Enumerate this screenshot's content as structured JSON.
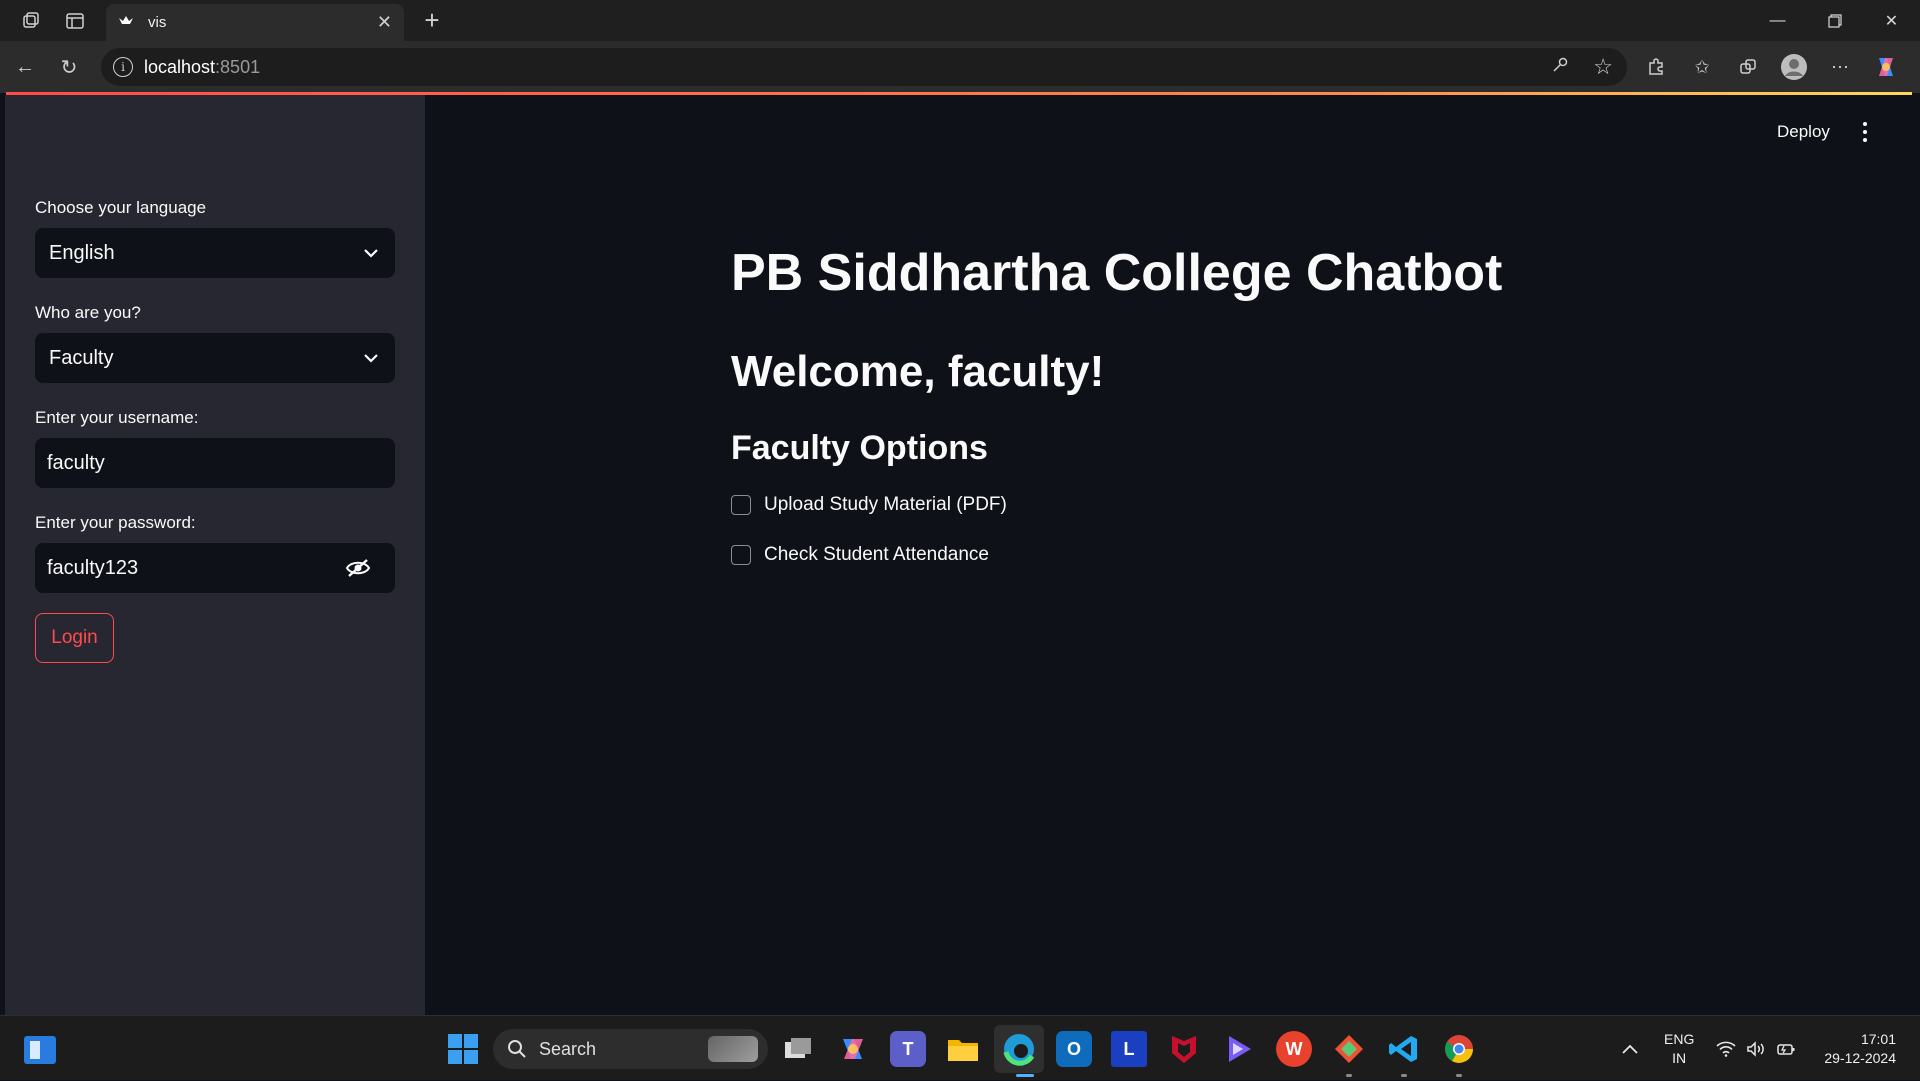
{
  "browser": {
    "tab_title": "vis",
    "url_host": "localhost",
    "url_port": ":8501"
  },
  "sidebar": {
    "language": {
      "label": "Choose your language",
      "value": "English"
    },
    "role": {
      "label": "Who are you?",
      "value": "Faculty"
    },
    "username": {
      "label": "Enter your username:",
      "value": "faculty"
    },
    "password": {
      "label": "Enter your password:",
      "value": "faculty123"
    },
    "login_label": "Login"
  },
  "header": {
    "deploy_label": "Deploy"
  },
  "main": {
    "title": "PB Siddhartha College Chatbot",
    "welcome": "Welcome, faculty!",
    "section_title": "Faculty Options",
    "options": [
      {
        "label": "Upload Study Material (PDF)",
        "checked": false
      },
      {
        "label": "Check Student Attendance",
        "checked": false
      }
    ]
  },
  "taskbar": {
    "search_label": "Search",
    "language_line1": "ENG",
    "language_line2": "IN",
    "time": "17:01",
    "date": "29-12-2024"
  },
  "colors": {
    "accent": "#ff4b4b",
    "sidebar_bg": "#262730",
    "main_bg": "#0e1117"
  }
}
